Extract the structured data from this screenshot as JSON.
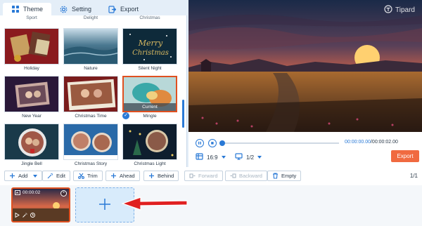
{
  "tabs": [
    {
      "label": "Theme",
      "icon": "grid-icon",
      "active": true
    },
    {
      "label": "Setting",
      "icon": "gear-icon",
      "active": false
    },
    {
      "label": "Export",
      "icon": "export-icon",
      "active": false
    }
  ],
  "themes": {
    "top_row_labels": [
      "Sport",
      "Delight",
      "Christmas"
    ],
    "items": [
      {
        "label": "Holiday"
      },
      {
        "label": "Nature"
      },
      {
        "label": "Silent Night",
        "overlay_text": "Merry Christmas"
      },
      {
        "label": "New Year"
      },
      {
        "label": "Christmas Time"
      },
      {
        "label": "Mingle",
        "selected": true,
        "badge": "Current"
      },
      {
        "label": "Jingle Bell"
      },
      {
        "label": "Christmas Story"
      },
      {
        "label": "Christmas Light"
      }
    ]
  },
  "brand": {
    "name": "Tipard"
  },
  "player": {
    "current_time": "00:00:00.00",
    "total_time": "/00:00:02.00",
    "progress": 0.0,
    "aspect_ratio": "16:9",
    "page": "1/2",
    "export_label": "Export"
  },
  "toolbar": {
    "add": "Add",
    "edit": "Edit",
    "trim": "Trim",
    "ahead": "Ahead",
    "behind": "Behind",
    "forward": "Forward",
    "backward": "Backward",
    "empty": "Empty",
    "page_indicator": "1/1"
  },
  "timeline": {
    "clip_duration": "00:00:02"
  },
  "colors": {
    "accent": "#2979d6",
    "export": "#f06a40",
    "selection": "#e05020"
  }
}
